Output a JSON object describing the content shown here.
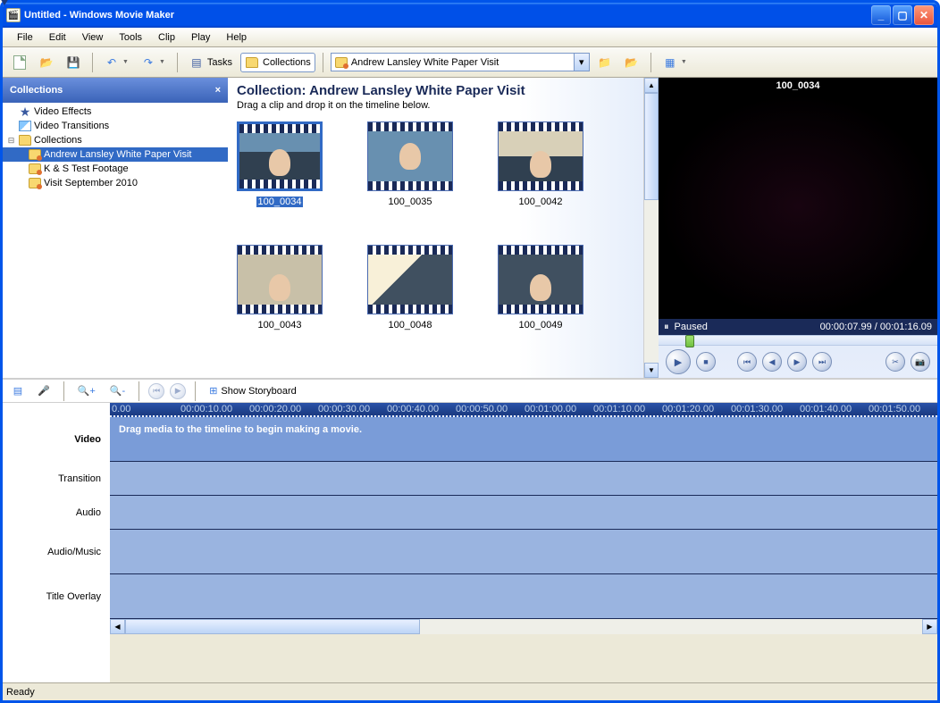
{
  "window": {
    "title": "Untitled - Windows Movie Maker"
  },
  "menubar": [
    "File",
    "Edit",
    "View",
    "Tools",
    "Clip",
    "Play",
    "Help"
  ],
  "toolbar": {
    "tasks": "Tasks",
    "collections": "Collections",
    "location": "Andrew Lansley White Paper Visit"
  },
  "sidebar": {
    "title": "Collections",
    "items": [
      {
        "label": "Video Effects",
        "icon": "star"
      },
      {
        "label": "Video Transitions",
        "icon": "trans"
      },
      {
        "label": "Collections",
        "icon": "folder",
        "expanded": true
      },
      {
        "label": "Andrew Lansley White Paper Visit",
        "icon": "reel",
        "selected": true,
        "child": true
      },
      {
        "label": "K & S Test Footage",
        "icon": "reel",
        "child": true
      },
      {
        "label": "Visit September 2010",
        "icon": "reel",
        "child": true
      }
    ]
  },
  "collection": {
    "heading": "Collection: Andrew Lansley White Paper Visit",
    "hint": "Drag a clip and drop it on the timeline below.",
    "clips": [
      {
        "label": "100_0034",
        "selected": true
      },
      {
        "label": "100_0035"
      },
      {
        "label": "100_0042"
      },
      {
        "label": "100_0043"
      },
      {
        "label": "100_0048"
      },
      {
        "label": "100_0049"
      }
    ]
  },
  "preview": {
    "clip_title": "100_0034",
    "state": "Paused",
    "time": "00:00:07.99 / 00:01:16.09"
  },
  "timeline_toolbar": {
    "show_storyboard": "Show Storyboard"
  },
  "timeline": {
    "ruler": [
      "0.00",
      "00:00:10.00",
      "00:00:20.00",
      "00:00:30.00",
      "00:00:40.00",
      "00:00:50.00",
      "00:01:00.00",
      "00:01:10.00",
      "00:01:20.00",
      "00:01:30.00",
      "00:01:40.00",
      "00:01:50.00"
    ],
    "tracks": {
      "video": "Video",
      "transition": "Transition",
      "audio": "Audio",
      "audio_music": "Audio/Music",
      "title_overlay": "Title Overlay"
    },
    "hint": "Drag media to the timeline to begin making a movie."
  },
  "status": "Ready"
}
